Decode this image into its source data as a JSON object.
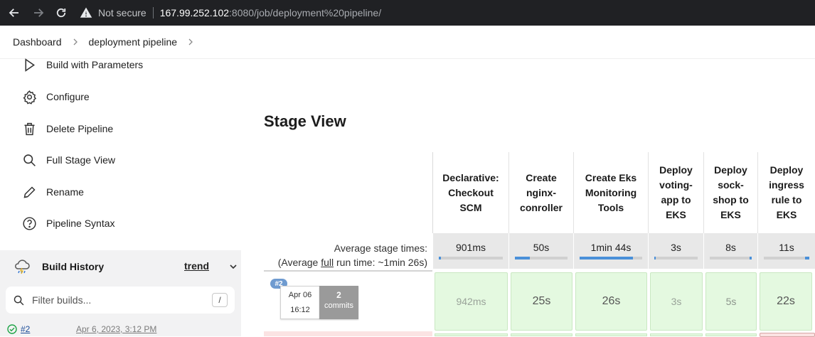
{
  "browser": {
    "security_label": "Not secure",
    "url_host": "167.99.252.102",
    "url_rest": ":8080/job/deployment%20pipeline/"
  },
  "breadcrumb": {
    "items": [
      "Dashboard",
      "deployment pipeline"
    ]
  },
  "sidebar": {
    "tasks": [
      {
        "label": "Build with Parameters",
        "icon": "play-icon"
      },
      {
        "label": "Configure",
        "icon": "gear-icon"
      },
      {
        "label": "Delete Pipeline",
        "icon": "trash-icon"
      },
      {
        "label": "Full Stage View",
        "icon": "search-icon"
      },
      {
        "label": "Rename",
        "icon": "pencil-icon"
      },
      {
        "label": "Pipeline Syntax",
        "icon": "help-circle-icon"
      }
    ],
    "build_history": {
      "title": "Build History",
      "trend_label": "trend",
      "filter_placeholder": "Filter builds...",
      "shortcut_key": "/",
      "builds": [
        {
          "number": "#2",
          "date": "Apr 6, 2023, 3:12 PM",
          "status": "success"
        }
      ]
    }
  },
  "stage_view": {
    "title": "Stage View",
    "avg_label_line1": "Average stage times:",
    "avg_label_line2_prefix": "(Average ",
    "avg_label_line2_link": "full",
    "avg_label_line2_suffix": " run time: ~1min 26s)",
    "stages": [
      {
        "name": "Declarative: Checkout SCM",
        "avg": "901ms",
        "avg_fraction": 0.0
      },
      {
        "name": "Create nginx-conroller",
        "avg": "50s",
        "avg_fraction": 0.28
      },
      {
        "name": "Create Eks Monitoring Tools",
        "avg": "1min 44s",
        "avg_fraction": 0.85
      },
      {
        "name": "Deploy voting-app to EKS",
        "avg": "3s",
        "avg_fraction": 0.03
      },
      {
        "name": "Deploy sock-shop to EKS",
        "avg": "8s",
        "avg_fraction": 0.05
      },
      {
        "name": "Deploy ingress rule to EKS",
        "avg": "11s",
        "avg_fraction": 0.1
      }
    ],
    "build": {
      "badge": "#2",
      "date": "Apr 06",
      "time": "16:12",
      "commits_count": "2",
      "commits_label": "commits",
      "stage_times": [
        "942ms",
        "25s",
        "26s",
        "3s",
        "5s",
        "22s"
      ]
    }
  }
}
